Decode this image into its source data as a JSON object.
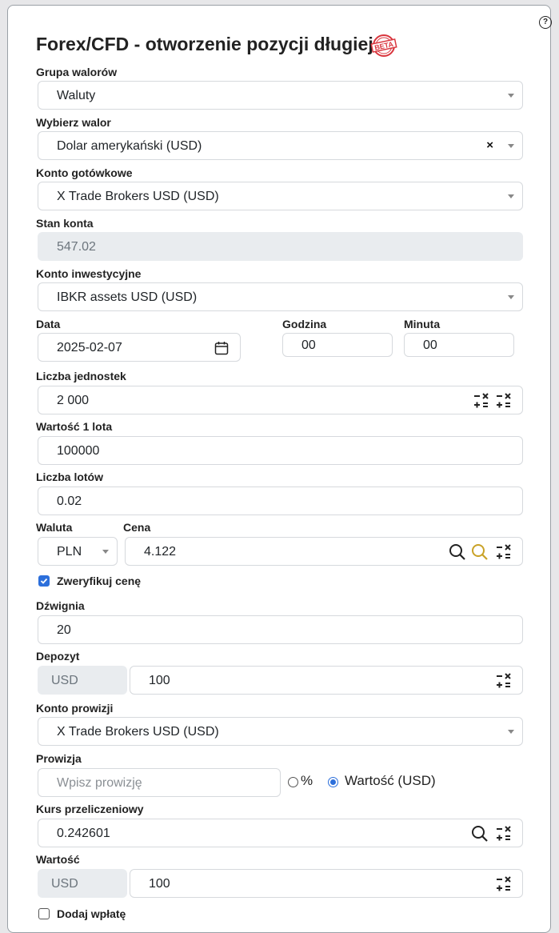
{
  "help_icon_glyph": "?",
  "title": "Forex/CFD - otworzenie pozycji długiej",
  "beta_badge": "BETA",
  "group": {
    "label": "Grupa walorów",
    "value": "Waluty"
  },
  "asset": {
    "label": "Wybierz walor",
    "value": "Dolar amerykański (USD)",
    "clear": "×"
  },
  "cash_account": {
    "label": "Konto gotówkowe",
    "value": "X Trade Brokers USD (USD)"
  },
  "balance": {
    "label": "Stan konta",
    "value": "547.02"
  },
  "investment_account": {
    "label": "Konto inwestycyjne",
    "value": "IBKR assets USD (USD)"
  },
  "date": {
    "label": "Data",
    "value": "2025-02-07"
  },
  "hour": {
    "label": "Godzina",
    "value": "00"
  },
  "minute": {
    "label": "Minuta",
    "value": "00"
  },
  "units": {
    "label": "Liczba jednostek",
    "value": "2 000"
  },
  "lot_value": {
    "label": "Wartość 1 lota",
    "value": "100000"
  },
  "lots": {
    "label": "Liczba lotów",
    "value": "0.02"
  },
  "currency": {
    "label": "Waluta",
    "value": "PLN"
  },
  "price": {
    "label": "Cena",
    "value": "4.122"
  },
  "verify_price": {
    "label": "Zweryfikuj cenę",
    "checked": true
  },
  "leverage": {
    "label": "Dźwignia",
    "value": "20"
  },
  "deposit": {
    "label": "Depozyt",
    "currency": "USD",
    "value": "100"
  },
  "commission_account": {
    "label": "Konto prowizji",
    "value": "X Trade Brokers USD (USD)"
  },
  "commission": {
    "label": "Prowizja",
    "placeholder": "Wpisz prowizję",
    "option_percent": "%",
    "option_value": "Wartość (USD)",
    "selected": "value"
  },
  "conversion_rate": {
    "label": "Kurs przeliczeniowy",
    "value": "0.242601"
  },
  "value": {
    "label": "Wartość",
    "currency": "USD",
    "amount": "100"
  },
  "add_deposit": {
    "label": "Dodaj wpłatę",
    "checked": false
  },
  "colors": {
    "accent": "#2c6fdb",
    "beta_red": "#d9363e",
    "search_gold": "#c9a227"
  }
}
